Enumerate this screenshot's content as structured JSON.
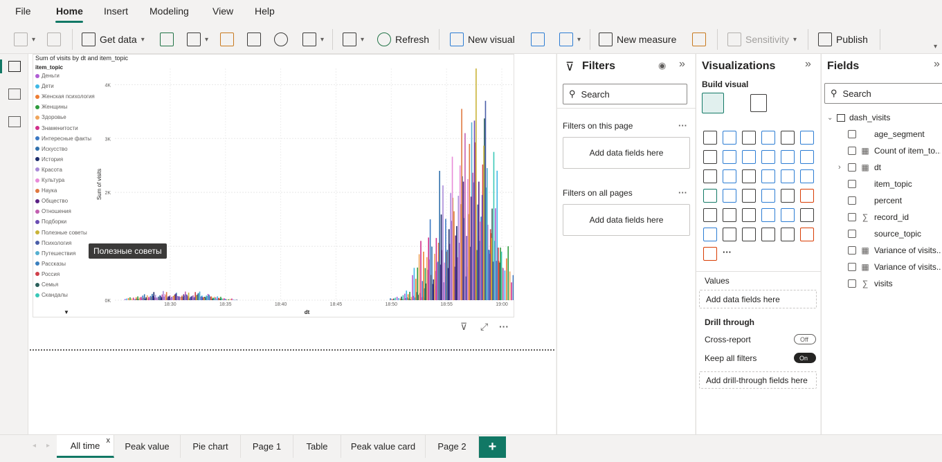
{
  "menu": {
    "items": [
      "File",
      "Home",
      "Insert",
      "Modeling",
      "View",
      "Help"
    ]
  },
  "ribbon": {
    "get_data": "Get data",
    "refresh": "Refresh",
    "new_visual": "New visual",
    "new_measure": "New measure",
    "sensitivity": "Sensitivity",
    "publish": "Publish"
  },
  "visual": {
    "title": "Sum of visits by dt and item_topic",
    "legend_title": "item_topic",
    "legend": [
      {
        "name": "Деньги",
        "color": "#b05ed4"
      },
      {
        "name": "Дети",
        "color": "#3fb8e6"
      },
      {
        "name": "Женская психология",
        "color": "#ee7d33"
      },
      {
        "name": "Женщины",
        "color": "#2e9b3c"
      },
      {
        "name": "Здоровье",
        "color": "#f0a55b"
      },
      {
        "name": "Знаменитости",
        "color": "#d12e8a"
      },
      {
        "name": "Интересные факты",
        "color": "#3b78c4"
      },
      {
        "name": "Искусство",
        "color": "#2f6fab"
      },
      {
        "name": "История",
        "color": "#1c2b6b"
      },
      {
        "name": "Красота",
        "color": "#a98ad8"
      },
      {
        "name": "Культура",
        "color": "#e88ad8"
      },
      {
        "name": "Наука",
        "color": "#e07840"
      },
      {
        "name": "Общество",
        "color": "#5b2185"
      },
      {
        "name": "Отношения",
        "color": "#c25fb0"
      },
      {
        "name": "Подборки",
        "color": "#6a4db3"
      },
      {
        "name": "Полезные советы",
        "color": "#c9b338"
      },
      {
        "name": "Психология",
        "color": "#4a5ea8"
      },
      {
        "name": "Путешествия",
        "color": "#56b0d0"
      },
      {
        "name": "Рассказы",
        "color": "#3a7fbe"
      },
      {
        "name": "Россия",
        "color": "#d0404a"
      },
      {
        "name": "Семья",
        "color": "#2b5f5a"
      },
      {
        "name": "Скандалы",
        "color": "#3ac8b8"
      }
    ],
    "tooltip": "Полезные советы"
  },
  "chart_data": {
    "type": "bar",
    "title": "Sum of visits by dt and item_topic",
    "xlabel": "dt",
    "ylabel": "Sum of visits",
    "x_ticks": [
      "18:30",
      "18:35",
      "18:40",
      "18:45",
      "18:50",
      "18:55",
      "19:00"
    ],
    "y_ticks": [
      "0K",
      "1K",
      "2K",
      "3K",
      "4K"
    ],
    "ylim": [
      0,
      4300
    ],
    "grid": true,
    "legend_position": "left",
    "series_groups": [
      {
        "x": "18:27",
        "values": [
          40,
          60,
          30,
          50,
          35
        ]
      },
      {
        "x": "18:28",
        "values": [
          70,
          110,
          60,
          90,
          50
        ]
      },
      {
        "x": "18:29",
        "values": [
          90,
          150,
          80,
          120,
          70
        ]
      },
      {
        "x": "18:30",
        "values": [
          100,
          170,
          90,
          140,
          80
        ]
      },
      {
        "x": "18:31",
        "values": [
          80,
          140,
          70,
          110,
          60
        ]
      },
      {
        "x": "18:32",
        "values": [
          110,
          180,
          90,
          150,
          85
        ]
      },
      {
        "x": "18:33",
        "values": [
          90,
          160,
          80,
          130,
          70
        ]
      },
      {
        "x": "18:34",
        "values": [
          60,
          100,
          50,
          80,
          40
        ]
      },
      {
        "x": "18:35",
        "values": [
          20,
          40,
          15,
          30,
          10
        ]
      },
      {
        "x": "18:51",
        "values": [
          40,
          70,
          30,
          50,
          25
        ]
      },
      {
        "x": "18:52",
        "values": [
          120,
          200,
          90,
          150,
          70
        ]
      },
      {
        "x": "18:53",
        "values": [
          600,
          1100,
          400,
          850,
          300
        ]
      },
      {
        "x": "18:54",
        "values": [
          900,
          1500,
          700,
          1200,
          500
        ]
      },
      {
        "x": "18:55",
        "values": [
          1300,
          2400,
          900,
          1900,
          700
        ]
      },
      {
        "x": "18:56",
        "values": [
          1700,
          3000,
          1200,
          2300,
          800
        ]
      },
      {
        "x": "18:57",
        "values": [
          2500,
          4000,
          1800,
          3300,
          1200
        ]
      },
      {
        "x": "18:58",
        "values": [
          2900,
          4300,
          2000,
          3800,
          1400
        ]
      },
      {
        "x": "18:59",
        "values": [
          2200,
          3700,
          1700,
          3100,
          1100
        ]
      },
      {
        "x": "19:00",
        "values": [
          1300,
          1100,
          900,
          1000,
          600
        ]
      }
    ]
  },
  "filters": {
    "title": "Filters",
    "search": "Search",
    "on_page": "Filters on this page",
    "on_all": "Filters on all pages",
    "add": "Add data fields here"
  },
  "viz": {
    "title": "Visualizations",
    "build": "Build visual",
    "values": "Values",
    "values_add": "Add data fields here",
    "drill": "Drill through",
    "cross": "Cross-report",
    "cross_state": "Off",
    "keep": "Keep all filters",
    "keep_state": "On",
    "drill_add": "Add drill-through fields here"
  },
  "fields": {
    "title": "Fields",
    "search": "Search",
    "table": "dash_visits",
    "items": [
      {
        "name": "age_segment",
        "type": ""
      },
      {
        "name": "Count of item_to...",
        "type": "calc"
      },
      {
        "name": "dt",
        "type": "date"
      },
      {
        "name": "item_topic",
        "type": ""
      },
      {
        "name": "percent",
        "type": ""
      },
      {
        "name": "record_id",
        "type": "sum"
      },
      {
        "name": "source_topic",
        "type": ""
      },
      {
        "name": "Variance of visits...",
        "type": "calc"
      },
      {
        "name": "Variance of visits...",
        "type": "calc"
      },
      {
        "name": "visits",
        "type": "sum"
      }
    ]
  },
  "tabs": {
    "items": [
      "All time",
      "Peak value",
      "Pie chart",
      "Page 1",
      "Table",
      "Peak value card",
      "Page 2"
    ],
    "close": "x",
    "add": "+"
  }
}
